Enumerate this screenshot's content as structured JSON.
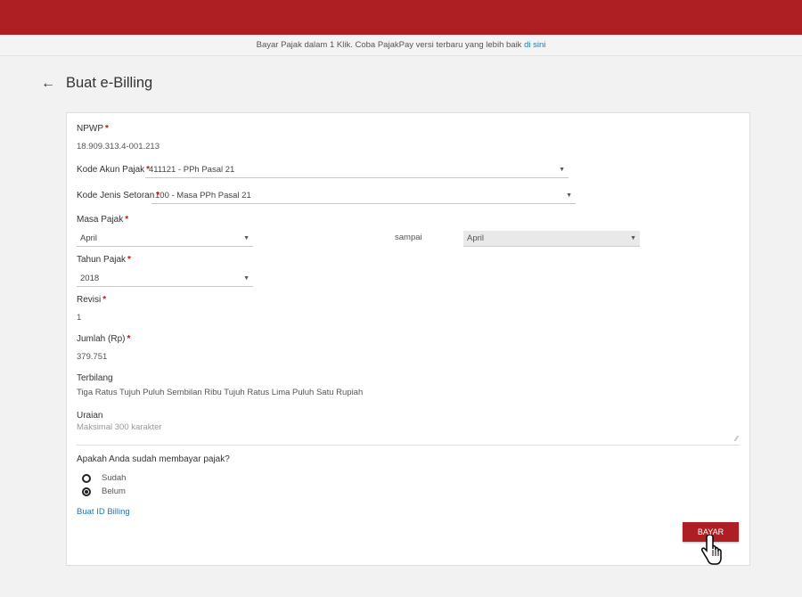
{
  "notice": {
    "text": "Bayar Pajak dalam 1 Klik. Coba PajakPay versi terbaru yang lebih baik ",
    "link": "di sini"
  },
  "page": {
    "back_icon": "←",
    "title": "Buat e-Billing"
  },
  "form": {
    "npwp_label": "NPWP",
    "npwp_value": "18.909.313.4-001.213",
    "kode_akun_label": "Kode Akun Pajak",
    "kode_akun_value": "411121 - PPh Pasal 21",
    "kode_jenis_label": "Kode Jenis Setoran",
    "kode_jenis_value": "100 - Masa PPh Pasal 21",
    "masa_label": "Masa Pajak",
    "masa_from": "April",
    "sampai_label": "sampai",
    "masa_to": "April",
    "tahun_label": "Tahun Pajak",
    "tahun_value": "2018",
    "revisi_label": "Revisi",
    "revisi_value": "1",
    "jumlah_label": "Jumlah (Rp)",
    "jumlah_value": "379.751",
    "terbilang_label": "Terbilang",
    "terbilang_value": "Tiga Ratus Tujuh Puluh Sembilan Ribu Tujuh Ratus Lima Puluh Satu Rupiah",
    "uraian_label": "Uraian",
    "uraian_placeholder": "Maksimal 300 karakter",
    "paid_question": "Apakah Anda sudah membayar pajak?",
    "options": [
      "Sudah",
      "Belum"
    ],
    "selected_option": "Belum",
    "create_link": "Buat ID Billing",
    "pay_button": "BAYAR"
  },
  "colors": {
    "brand": "#ad1f23",
    "link": "#1f77b4"
  }
}
